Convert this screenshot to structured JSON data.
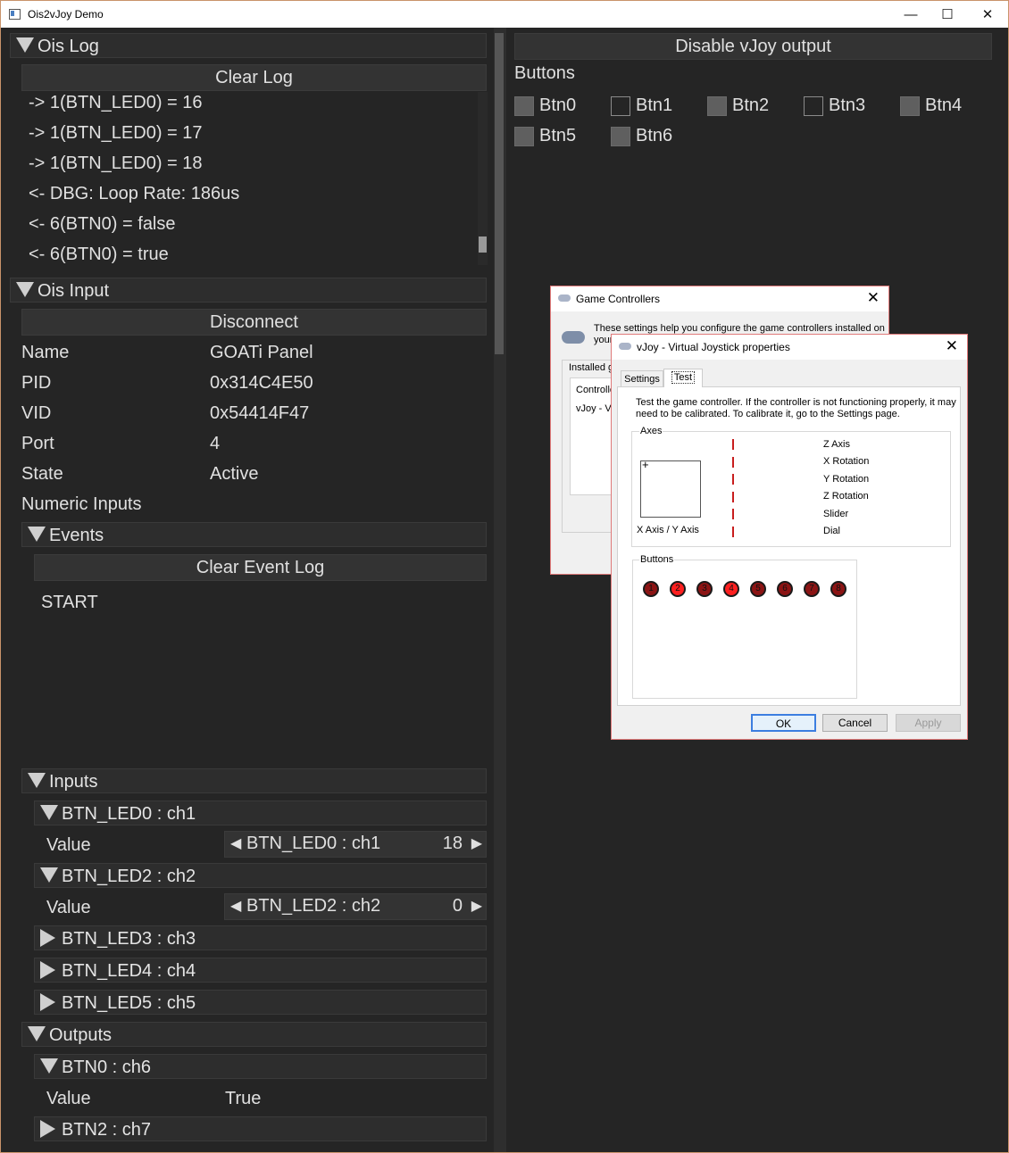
{
  "window": {
    "title": "Ois2vJoy Demo",
    "minimize": "—",
    "maximize": "☐",
    "close": "✕"
  },
  "left": {
    "ois_log": {
      "header": "Ois Log",
      "clear_button": "Clear Log",
      "lines": [
        "-> 1(BTN_LED0) = 16",
        "-> 1(BTN_LED0) = 17",
        "-> 1(BTN_LED0) = 18",
        "<- DBG: Loop Rate: 186us",
        "<- 6(BTN0) = false",
        "<- 6(BTN0) = true"
      ]
    },
    "ois_input": {
      "header": "Ois Input",
      "disconnect_button": "Disconnect",
      "props": [
        {
          "label": "Name",
          "value": "GOATi Panel"
        },
        {
          "label": "PID",
          "value": "0x314C4E50"
        },
        {
          "label": "VID",
          "value": "0x54414F47"
        },
        {
          "label": "Port",
          "value": "4"
        },
        {
          "label": "State",
          "value": "Active"
        }
      ],
      "numeric_inputs": "Numeric Inputs",
      "events": {
        "header": "Events",
        "clear_button": "Clear Event Log",
        "entries": [
          "START"
        ]
      },
      "inputs": {
        "header": "Inputs",
        "value_label": "Value",
        "items": [
          {
            "name": "BTN_LED0 : ch1",
            "expanded": true,
            "spin_label": "BTN_LED0 : ch1",
            "spin_value": "18"
          },
          {
            "name": "BTN_LED2 : ch2",
            "expanded": true,
            "spin_label": "BTN_LED2 : ch2",
            "spin_value": "0"
          },
          {
            "name": "BTN_LED3 : ch3",
            "expanded": false
          },
          {
            "name": "BTN_LED4 : ch4",
            "expanded": false
          },
          {
            "name": "BTN_LED5 : ch5",
            "expanded": false
          }
        ]
      },
      "outputs": {
        "header": "Outputs",
        "items": [
          {
            "name": "BTN0 : ch6",
            "expanded": true,
            "value_label": "Value",
            "value": "True"
          },
          {
            "name": "BTN2 : ch7",
            "expanded": false
          }
        ]
      }
    }
  },
  "right": {
    "disable_button": "Disable vJoy output",
    "buttons_label": "Buttons",
    "buttons": [
      {
        "label": "Btn0",
        "checked": true
      },
      {
        "label": "Btn1",
        "checked": false
      },
      {
        "label": "Btn2",
        "checked": true
      },
      {
        "label": "Btn3",
        "checked": false
      },
      {
        "label": "Btn4",
        "checked": true
      },
      {
        "label": "Btn5",
        "checked": true
      },
      {
        "label": "Btn6",
        "checked": true
      }
    ]
  },
  "game_controllers": {
    "title": "Game Controllers",
    "close": "✕",
    "desc_line1": "These settings help you configure the game controllers installed on",
    "desc_line2": "your",
    "installed": "Installed g",
    "list_header": "Controlle",
    "list_item": "vJoy - V"
  },
  "vjoy_props": {
    "title": "vJoy - Virtual Joystick properties",
    "close": "✕",
    "tabs": [
      "Settings",
      "Test"
    ],
    "instructions_line1": "Test the game controller.  If the controller is not functioning properly, it may",
    "instructions_line2": "need to be calibrated.  To calibrate it, go to the Settings page.",
    "axes_group": "Axes",
    "xy_label": "X Axis / Y Axis",
    "crosshair": "+",
    "axis_labels": [
      "Z Axis",
      "X Rotation",
      "Y Rotation",
      "Z Rotation",
      "Slider",
      "Dial"
    ],
    "buttons_group": "Buttons",
    "leds": [
      {
        "n": "1",
        "on": false
      },
      {
        "n": "2",
        "on": true
      },
      {
        "n": "3",
        "on": false
      },
      {
        "n": "4",
        "on": true
      },
      {
        "n": "5",
        "on": false
      },
      {
        "n": "6",
        "on": false
      },
      {
        "n": "7",
        "on": false
      },
      {
        "n": "8",
        "on": false
      }
    ],
    "ok": "OK",
    "cancel": "Cancel",
    "apply": "Apply",
    "colors": {
      "led_on": "#ff2020",
      "led_off": "#8b1414",
      "axis_marker": "#c81e1e"
    }
  }
}
